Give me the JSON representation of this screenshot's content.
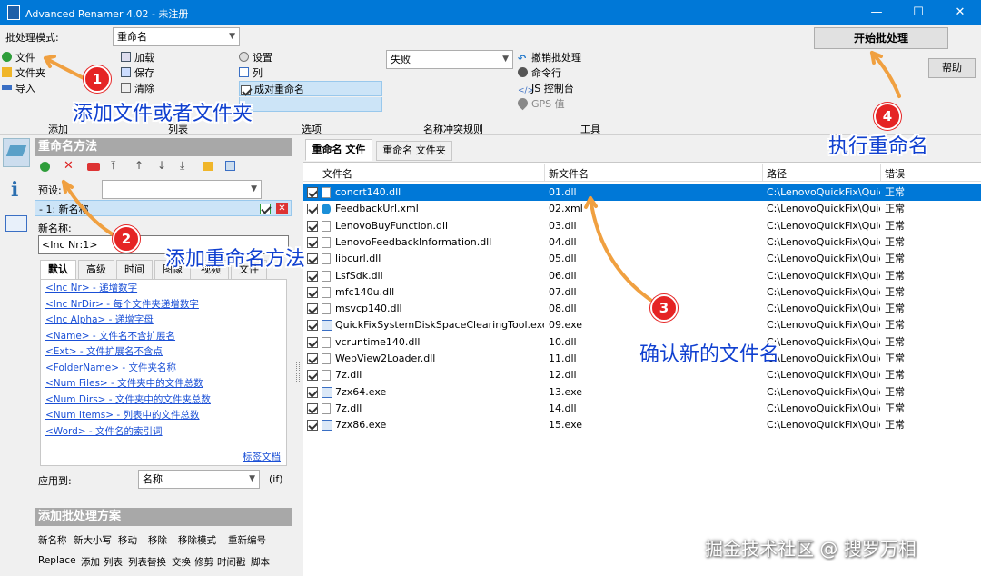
{
  "app": {
    "title": "Advanced Renamer 4.02 - 未注册",
    "accent": "#0078d7"
  },
  "toolbar": {
    "mode_label": "批处理模式:",
    "mode_value": "重命名",
    "add": [
      {
        "label": "文件",
        "icon": "plus-icon"
      },
      {
        "label": "文件夹",
        "icon": "folder-icon"
      },
      {
        "label": "导入",
        "icon": "import-icon"
      }
    ],
    "list": [
      {
        "label": "加载",
        "icon": "load-icon"
      },
      {
        "label": "保存",
        "icon": "save-icon"
      },
      {
        "label": "清除",
        "icon": "clear-icon"
      }
    ],
    "options": [
      {
        "label": "设置",
        "icon": "settings-icon"
      },
      {
        "label": "列",
        "icon": "columns-icon"
      },
      {
        "label": "成对重命名",
        "icon": "checkbox-icon"
      }
    ],
    "conflict_value": "失败",
    "tools": [
      {
        "label": "撤销批处理",
        "icon": "undo-icon"
      },
      {
        "label": "命令行",
        "icon": "gear-icon"
      },
      {
        "label": "JS 控制台",
        "icon": "code-icon"
      },
      {
        "label": "GPS 值",
        "icon": "pin-icon"
      }
    ],
    "groups": {
      "add": "添加",
      "list": "列表",
      "options": "选项",
      "conflict": "名称冲突规则",
      "tools": "工具"
    },
    "start_label": "开始批处理",
    "help_label": "帮助"
  },
  "methods": {
    "title": "重命名方法",
    "preset_label": "预设:",
    "method_title": "- 1: 新名称",
    "newname_label": "新名称:",
    "newname_value": "<Inc Nr:1>",
    "tabs": [
      "默认",
      "高级",
      "时间",
      "图像",
      "视频",
      "文件"
    ],
    "tags": [
      "<Inc Nr> - 递增数字",
      "<Inc NrDir> - 每个文件夹递增数字",
      "<Inc Alpha> - 递增字母",
      "<Name> - 文件名不含扩展名",
      "<Ext> - 文件扩展名不含点",
      "<FolderName> - 文件夹名称",
      "<Num Files> - 文件夹中的文件总数",
      "<Num Dirs> - 文件夹中的文件夹总数",
      "<Num Items> - 列表中的文件总数",
      "<Word> - 文件名的索引词"
    ],
    "tag_doc": "标签文档",
    "apply_label": "应用到:",
    "apply_value": "名称",
    "apply_extra": "(if)"
  },
  "batch": {
    "title": "添加批处理方案",
    "row1": [
      "新名称",
      "新大小写",
      "移动",
      "移除",
      "移除模式",
      "重新编号"
    ],
    "row2": [
      "Replace",
      "添加",
      "列表",
      "列表替换",
      "交换",
      "修剪",
      "时间戳",
      "脚本"
    ]
  },
  "file_tabs": [
    "重命名 文件",
    "重命名 文件夹"
  ],
  "columns": [
    "文件名",
    "新文件名",
    "路径",
    "错误"
  ],
  "files": [
    {
      "name": "concrt140.dll",
      "new": "01.dll",
      "path": "C:\\LenovoQuickFix\\Quic...",
      "err": "正常",
      "icon": "file-icon"
    },
    {
      "name": "FeedbackUrl.xml",
      "new": "02.xml",
      "path": "C:\\LenovoQuickFix\\Quic...",
      "err": "正常",
      "icon": "edge-icon"
    },
    {
      "name": "LenovoBuyFunction.dll",
      "new": "03.dll",
      "path": "C:\\LenovoQuickFix\\Quic...",
      "err": "正常",
      "icon": "file-icon"
    },
    {
      "name": "LenovoFeedbackInformation.dll",
      "new": "04.dll",
      "path": "C:\\LenovoQuickFix\\Quic...",
      "err": "正常",
      "icon": "file-icon"
    },
    {
      "name": "libcurl.dll",
      "new": "05.dll",
      "path": "C:\\LenovoQuickFix\\Quic...",
      "err": "正常",
      "icon": "file-icon"
    },
    {
      "name": "LsfSdk.dll",
      "new": "06.dll",
      "path": "C:\\LenovoQuickFix\\Quic...",
      "err": "正常",
      "icon": "file-icon"
    },
    {
      "name": "mfc140u.dll",
      "new": "07.dll",
      "path": "C:\\LenovoQuickFix\\Quic...",
      "err": "正常",
      "icon": "file-icon"
    },
    {
      "name": "msvcp140.dll",
      "new": "08.dll",
      "path": "C:\\LenovoQuickFix\\Quic...",
      "err": "正常",
      "icon": "file-icon"
    },
    {
      "name": "QuickFixSystemDiskSpaceClearingTool.exe",
      "new": "09.exe",
      "path": "C:\\LenovoQuickFix\\Quic...",
      "err": "正常",
      "icon": "exe-icon"
    },
    {
      "name": "vcruntime140.dll",
      "new": "10.dll",
      "path": "C:\\LenovoQuickFix\\Quic...",
      "err": "正常",
      "icon": "file-icon"
    },
    {
      "name": "WebView2Loader.dll",
      "new": "11.dll",
      "path": "C:\\LenovoQuickFix\\Quic...",
      "err": "正常",
      "icon": "file-icon"
    },
    {
      "name": "7z.dll",
      "new": "12.dll",
      "path": "C:\\LenovoQuickFix\\Quic...",
      "err": "正常",
      "icon": "file-icon"
    },
    {
      "name": "7zx64.exe",
      "new": "13.exe",
      "path": "C:\\LenovoQuickFix\\Quic...",
      "err": "正常",
      "icon": "exe-icon"
    },
    {
      "name": "7z.dll",
      "new": "14.dll",
      "path": "C:\\LenovoQuickFix\\Quic...",
      "err": "正常",
      "icon": "file-icon"
    },
    {
      "name": "7zx86.exe",
      "new": "15.exe",
      "path": "C:\\LenovoQuickFix\\Quic...",
      "err": "正常",
      "icon": "exe-icon"
    }
  ],
  "annotations": [
    {
      "num": "1",
      "text": "添加文件或者文件夹"
    },
    {
      "num": "2",
      "text": "添加重命名方法"
    },
    {
      "num": "3",
      "text": "确认新的文件名"
    },
    {
      "num": "4",
      "text": "执行重命名"
    }
  ],
  "watermark": "掘金技术社区 @ 搜罗万相"
}
